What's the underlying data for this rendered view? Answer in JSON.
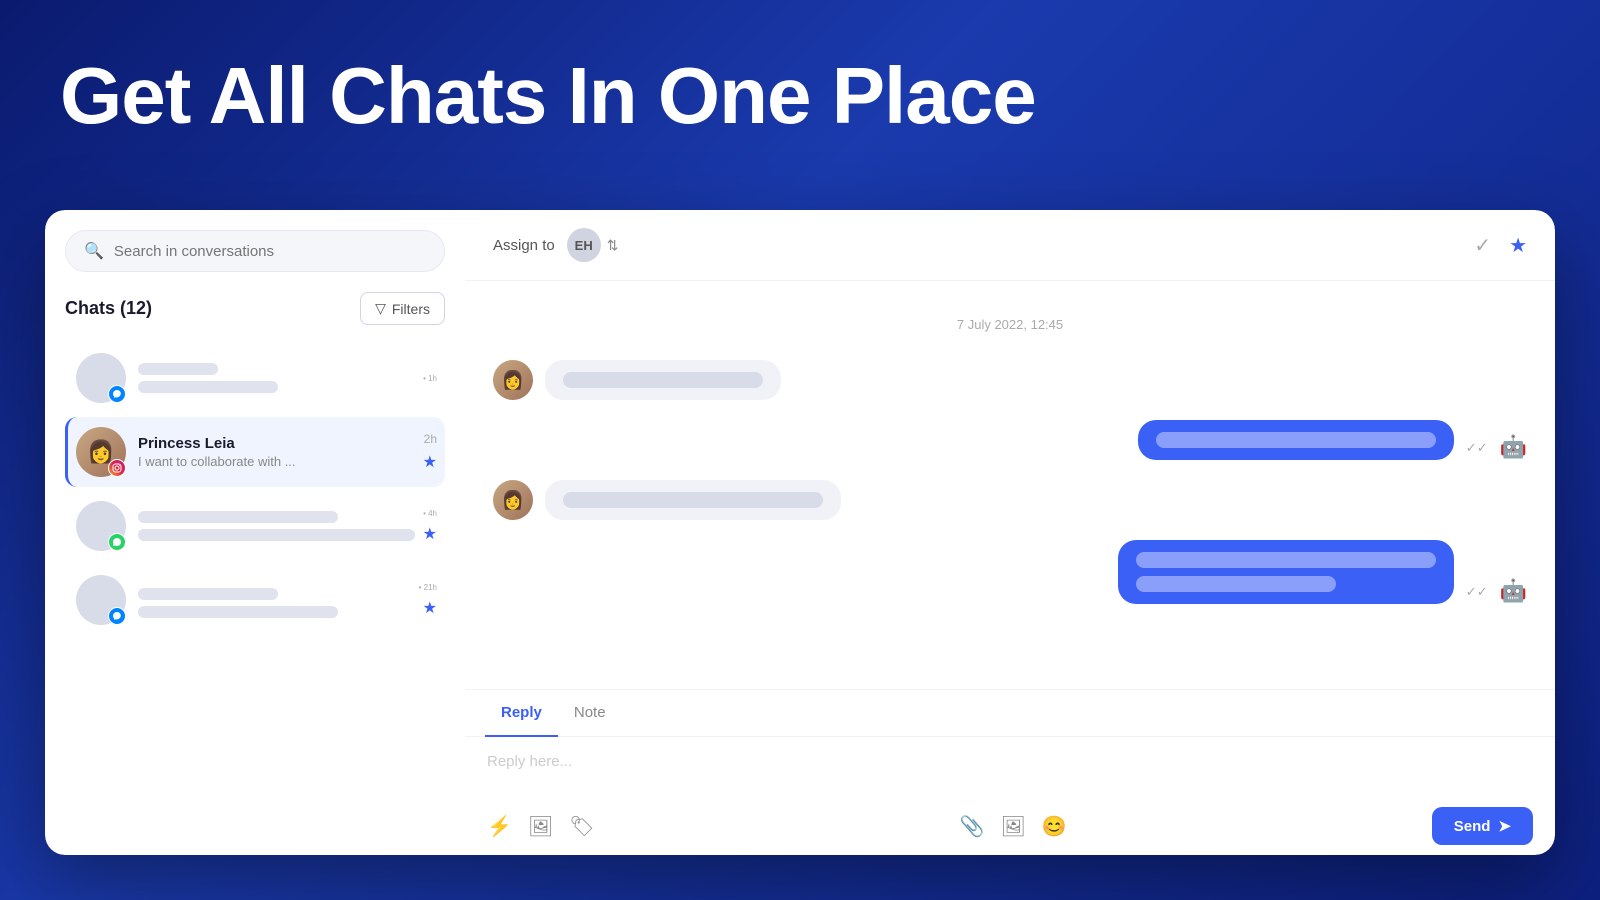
{
  "hero": {
    "title": "Get All Chats In One Place"
  },
  "platforms": [
    {
      "name": "whatsapp",
      "icon": "💬",
      "active": false
    },
    {
      "name": "instagram",
      "icon": "📷",
      "active": false
    },
    {
      "name": "messenger",
      "icon": "💬",
      "active": true
    }
  ],
  "sidebar": {
    "search_placeholder": "Search in conversations",
    "chats_title": "Chats (12)",
    "filters_label": "Filters",
    "chat_items": [
      {
        "id": 1,
        "name": "",
        "preview": "",
        "time": "1h",
        "platform": "messenger",
        "active": false,
        "starred": false
      },
      {
        "id": 2,
        "name": "Princess Leia",
        "preview": "I want to collaborate with ...",
        "time": "2h",
        "platform": "instagram",
        "active": true,
        "starred": true
      },
      {
        "id": 3,
        "name": "",
        "preview": "",
        "time": "4h",
        "platform": "whatsapp",
        "active": false,
        "starred": true
      },
      {
        "id": 4,
        "name": "",
        "preview": "",
        "time": "21h",
        "platform": "messenger",
        "active": false,
        "starred": true
      }
    ]
  },
  "chat_panel": {
    "assign_label": "Assign to",
    "assignee_initials": "EH",
    "date": "7 July 2022, 12:45",
    "messages": [
      {
        "direction": "incoming",
        "type": "placeholder"
      },
      {
        "direction": "outgoing",
        "type": "placeholder"
      },
      {
        "direction": "incoming",
        "type": "placeholder"
      },
      {
        "direction": "outgoing",
        "type": "placeholder"
      }
    ]
  },
  "reply_area": {
    "tab_reply": "Reply",
    "tab_note": "Note",
    "placeholder": "Reply here...",
    "send_label": "Send"
  }
}
